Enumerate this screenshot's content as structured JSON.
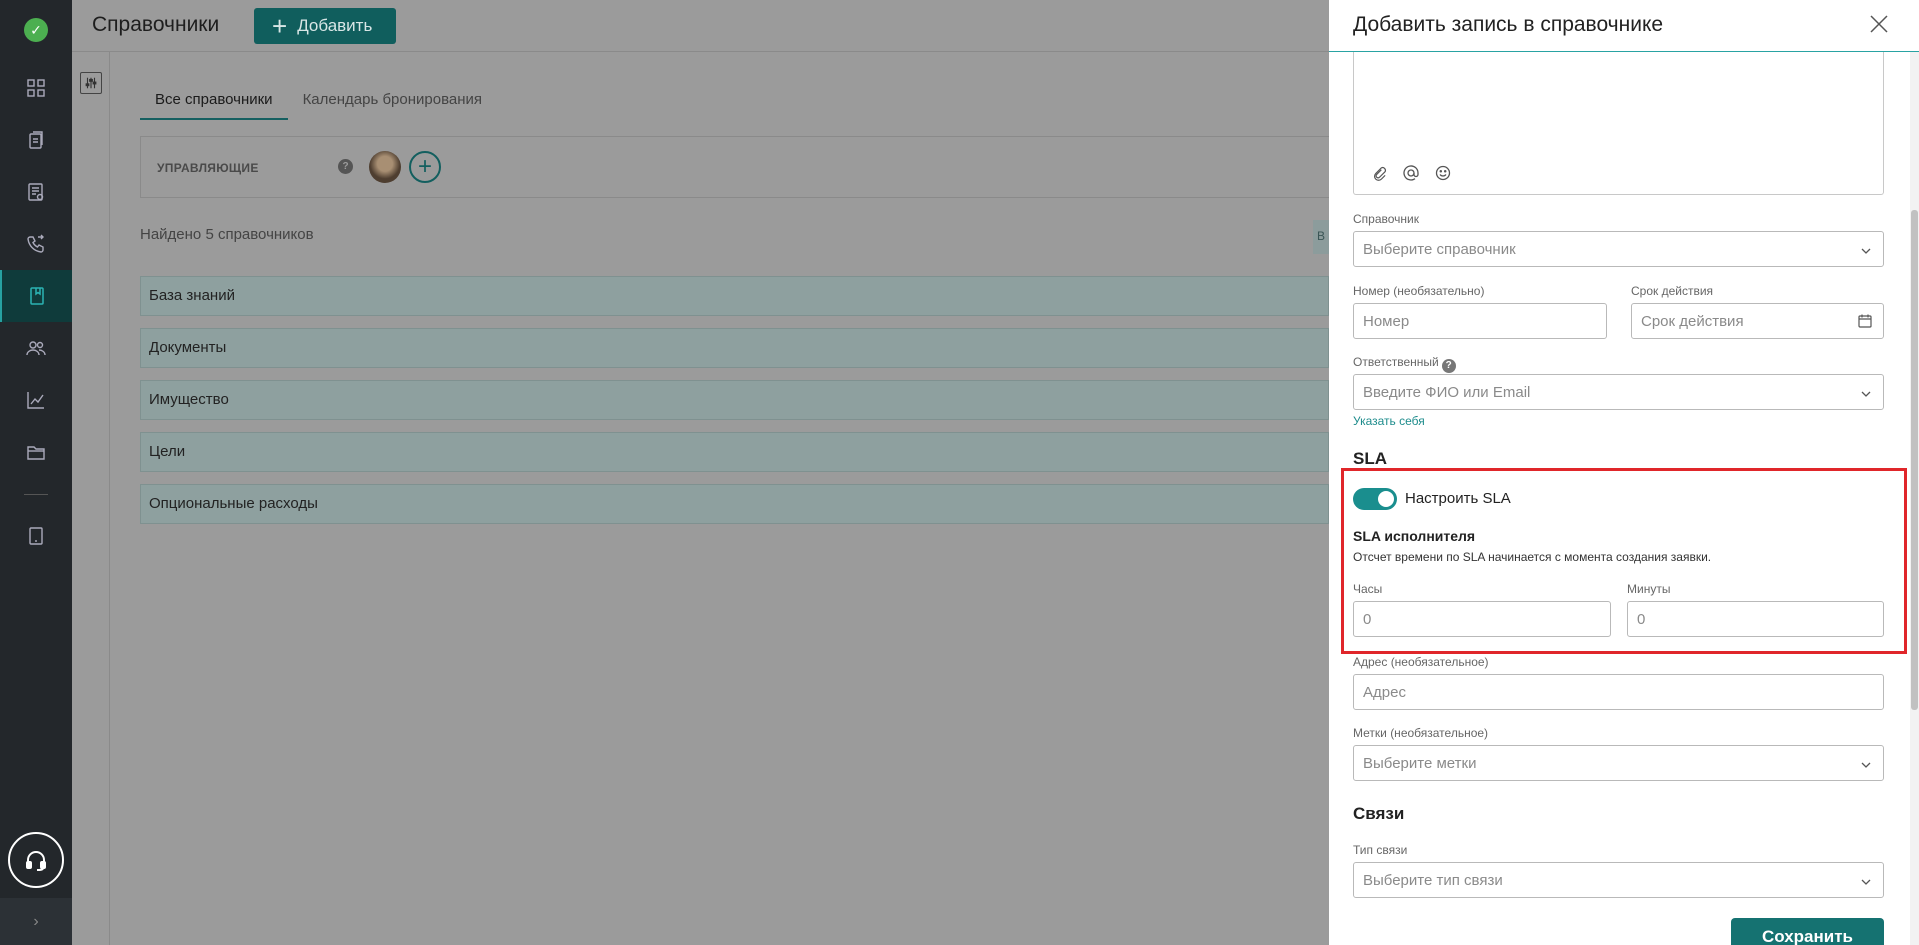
{
  "page": {
    "title": "Справочники",
    "add_button": "Добавить",
    "tabs": [
      {
        "label": "Все справочники",
        "active": true
      },
      {
        "label": "Календарь бронирования",
        "active": false
      }
    ],
    "managers_label": "УПРАВЛЯЮЩИЕ",
    "help_mark": "?",
    "found_text": "Найдено 5 справочников",
    "found_button_fragment": "В",
    "directories": [
      "База знаний",
      "Документы",
      "Имущество",
      "Цели",
      "Опциональные расходы"
    ]
  },
  "panel": {
    "title": "Добавить запись в справочнике",
    "directory": {
      "label": "Справочник",
      "placeholder": "Выберите справочник"
    },
    "number": {
      "label": "Номер (необязательно)",
      "placeholder": "Номер"
    },
    "validity": {
      "label": "Срок действия",
      "placeholder": "Срок действия"
    },
    "responsible": {
      "label": "Ответственный",
      "help": "?",
      "placeholder": "Введите ФИО или Email"
    },
    "assign_self": "Указать себя",
    "sla_title": "SLA",
    "sla_toggle_label": "Настроить SLA",
    "sla_toggle_on": true,
    "sla_executor_title": "SLA исполнителя",
    "sla_executor_desc": "Отсчет времени по SLA начинается с момента создания заявки.",
    "hours": {
      "label": "Часы",
      "placeholder": "0"
    },
    "minutes": {
      "label": "Минуты",
      "placeholder": "0"
    },
    "address": {
      "label": "Адрес (необязательное)",
      "placeholder": "Адрес"
    },
    "tags": {
      "label": "Метки (необязательное)",
      "placeholder": "Выберите метки"
    },
    "links_title": "Связи",
    "link_type": {
      "label": "Тип связи",
      "placeholder": "Выберите тип связи"
    },
    "save_button": "Сохранить"
  },
  "colors": {
    "accent": "#1a8e8e",
    "highlight_box": "#e0262a",
    "nav_bg": "#23272b"
  },
  "nav_icons": [
    "check-logo-icon",
    "dashboard-icon",
    "clipboard-icon",
    "document-icon",
    "phone-icon",
    "book-icon",
    "users-icon",
    "chart-icon",
    "folder-icon",
    "tablet-icon",
    "headset-icon",
    "chevron-right-icon"
  ]
}
